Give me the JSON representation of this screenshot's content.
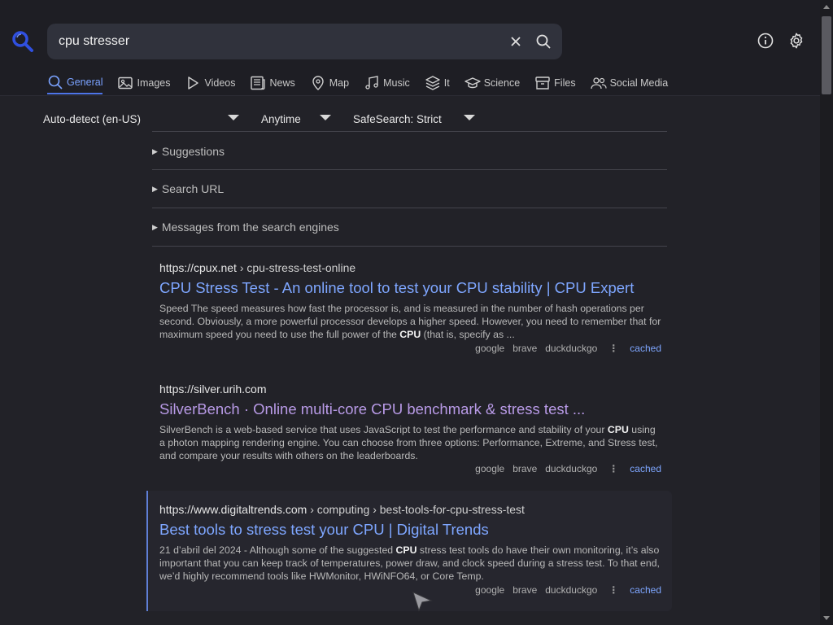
{
  "search": {
    "query": "cpu stresser"
  },
  "categories": [
    {
      "label": "General",
      "icon": "search-icon",
      "active": true
    },
    {
      "label": "Images",
      "icon": "image-icon"
    },
    {
      "label": "Videos",
      "icon": "play-icon"
    },
    {
      "label": "News",
      "icon": "newspaper-icon"
    },
    {
      "label": "Map",
      "icon": "map-pin-icon"
    },
    {
      "label": "Music",
      "icon": "music-icon"
    },
    {
      "label": "It",
      "icon": "layers-icon"
    },
    {
      "label": "Science",
      "icon": "graduation-cap-icon"
    },
    {
      "label": "Files",
      "icon": "archive-icon"
    },
    {
      "label": "Social Media",
      "icon": "people-icon"
    }
  ],
  "filters": {
    "language": "Auto-detect (en-US)",
    "time": "Anytime",
    "safesearch": "SafeSearch: Strict"
  },
  "collapsibles": {
    "suggestions": "Suggestions",
    "search_url": "Search URL",
    "messages": "Messages from the search engines"
  },
  "results": [
    {
      "host": "https://cpux.net",
      "path": "› cpu-stress-test-online",
      "title": "CPU Stress Test - An online tool to test your CPU stability | CPU Expert",
      "snippet_before": "Speed The speed measures how fast the processor is, and is measured in the number of hash operations per second. Obviously, a more powerful processor develops a higher speed. However, you need to remember that for maximum speed you need to use the full power of the ",
      "snippet_bold": "CPU",
      "snippet_after": " (that is, specify as ...",
      "engines": [
        "google",
        "brave",
        "duckduckgo"
      ],
      "dots": "⋮",
      "cached": "cached"
    },
    {
      "host": "https://silver.urih.com",
      "path": "",
      "title": "SilverBench · Online multi-core CPU benchmark & stress test ...",
      "snippet_before": "SilverBench is a web-based service that uses JavaScript to test the performance and stability of your ",
      "snippet_bold": "CPU",
      "snippet_after": " using a photon mapping rendering engine. You can choose from three options: Performance, Extreme, and Stress test, and compare your results with others on the leaderboards.",
      "engines": [
        "google",
        "brave",
        "duckduckgo"
      ],
      "dots": "⋮",
      "cached": "cached"
    },
    {
      "host": "https://www.digitaltrends.com",
      "path": "› computing › best-tools-for-cpu-stress-test",
      "title": "Best tools to stress test your CPU | Digital Trends",
      "snippet_before": "21 d’abril del 2024 - Although some of the suggested ",
      "snippet_bold": "CPU",
      "snippet_after": " stress test tools do have their own monitoring, it’s also important that you can keep track of temperatures, power draw, and clock speed during a stress test. To that end, we’d highly recommend tools like HWMonitor, HWiNFO64, or Core Temp.",
      "engines": [
        "google",
        "brave",
        "duckduckgo"
      ],
      "dots": "⋮",
      "cached": "cached"
    }
  ],
  "colors": {
    "accent": "#4d74e8",
    "link": "#7ea6ff",
    "visited": "#b89ae6",
    "background": "#222228"
  }
}
